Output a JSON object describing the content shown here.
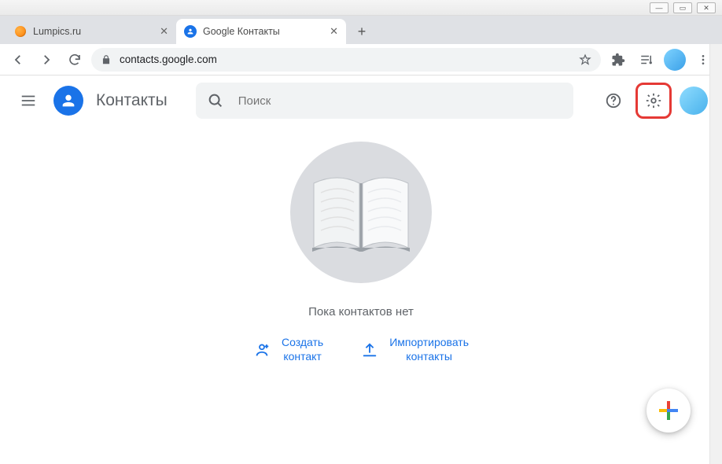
{
  "window": {
    "tabs": [
      {
        "title": "Lumpics.ru",
        "active": false
      },
      {
        "title": "Google Контакты",
        "active": true
      }
    ],
    "address": "contacts.google.com"
  },
  "header": {
    "product_name": "Контакты",
    "search_placeholder": "Поиск"
  },
  "main": {
    "empty_text": "Пока контактов нет",
    "create_label": "Создать\nконтакт",
    "import_label": "Импортировать\nконтакты"
  }
}
